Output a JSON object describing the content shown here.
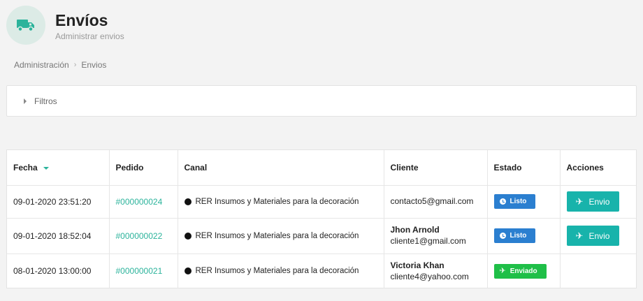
{
  "header": {
    "title": "Envíos",
    "subtitle": "Administrar envios",
    "icon": "truck-icon",
    "icon_bg": "#dcebe6",
    "icon_color": "#2bb39b"
  },
  "breadcrumb": [
    "Administración",
    "Envios"
  ],
  "filters": {
    "label": "Filtros"
  },
  "table": {
    "columns": [
      "Fecha",
      "Pedido",
      "Canal",
      "Cliente",
      "Estado",
      "Acciones"
    ],
    "sorted_column": "Fecha",
    "rows": [
      {
        "fecha": "09-01-2020 23:51:20",
        "pedido": "#000000024",
        "canal": "RER Insumos y Materiales para la decoración",
        "cliente_nombre": "",
        "cliente_email": "contacto5@gmail.com",
        "estado": "Listo",
        "accion": "Envio"
      },
      {
        "fecha": "09-01-2020 18:52:04",
        "pedido": "#000000022",
        "canal": "RER Insumos y Materiales para la decoración",
        "cliente_nombre": "Jhon Arnold",
        "cliente_email": "cliente1@gmail.com",
        "estado": "Listo",
        "accion": "Envio"
      },
      {
        "fecha": "08-01-2020 13:00:00",
        "pedido": "#000000021",
        "canal": "RER Insumos y Materiales para la decoración",
        "cliente_nombre": "Victoria Khan",
        "cliente_email": "cliente4@yahoo.com",
        "estado": "Enviado",
        "accion": ""
      }
    ]
  },
  "colors": {
    "accent": "#2bb39b",
    "listo": "#2b7fd0",
    "enviado": "#1fbf48",
    "button": "#18b3ab"
  }
}
